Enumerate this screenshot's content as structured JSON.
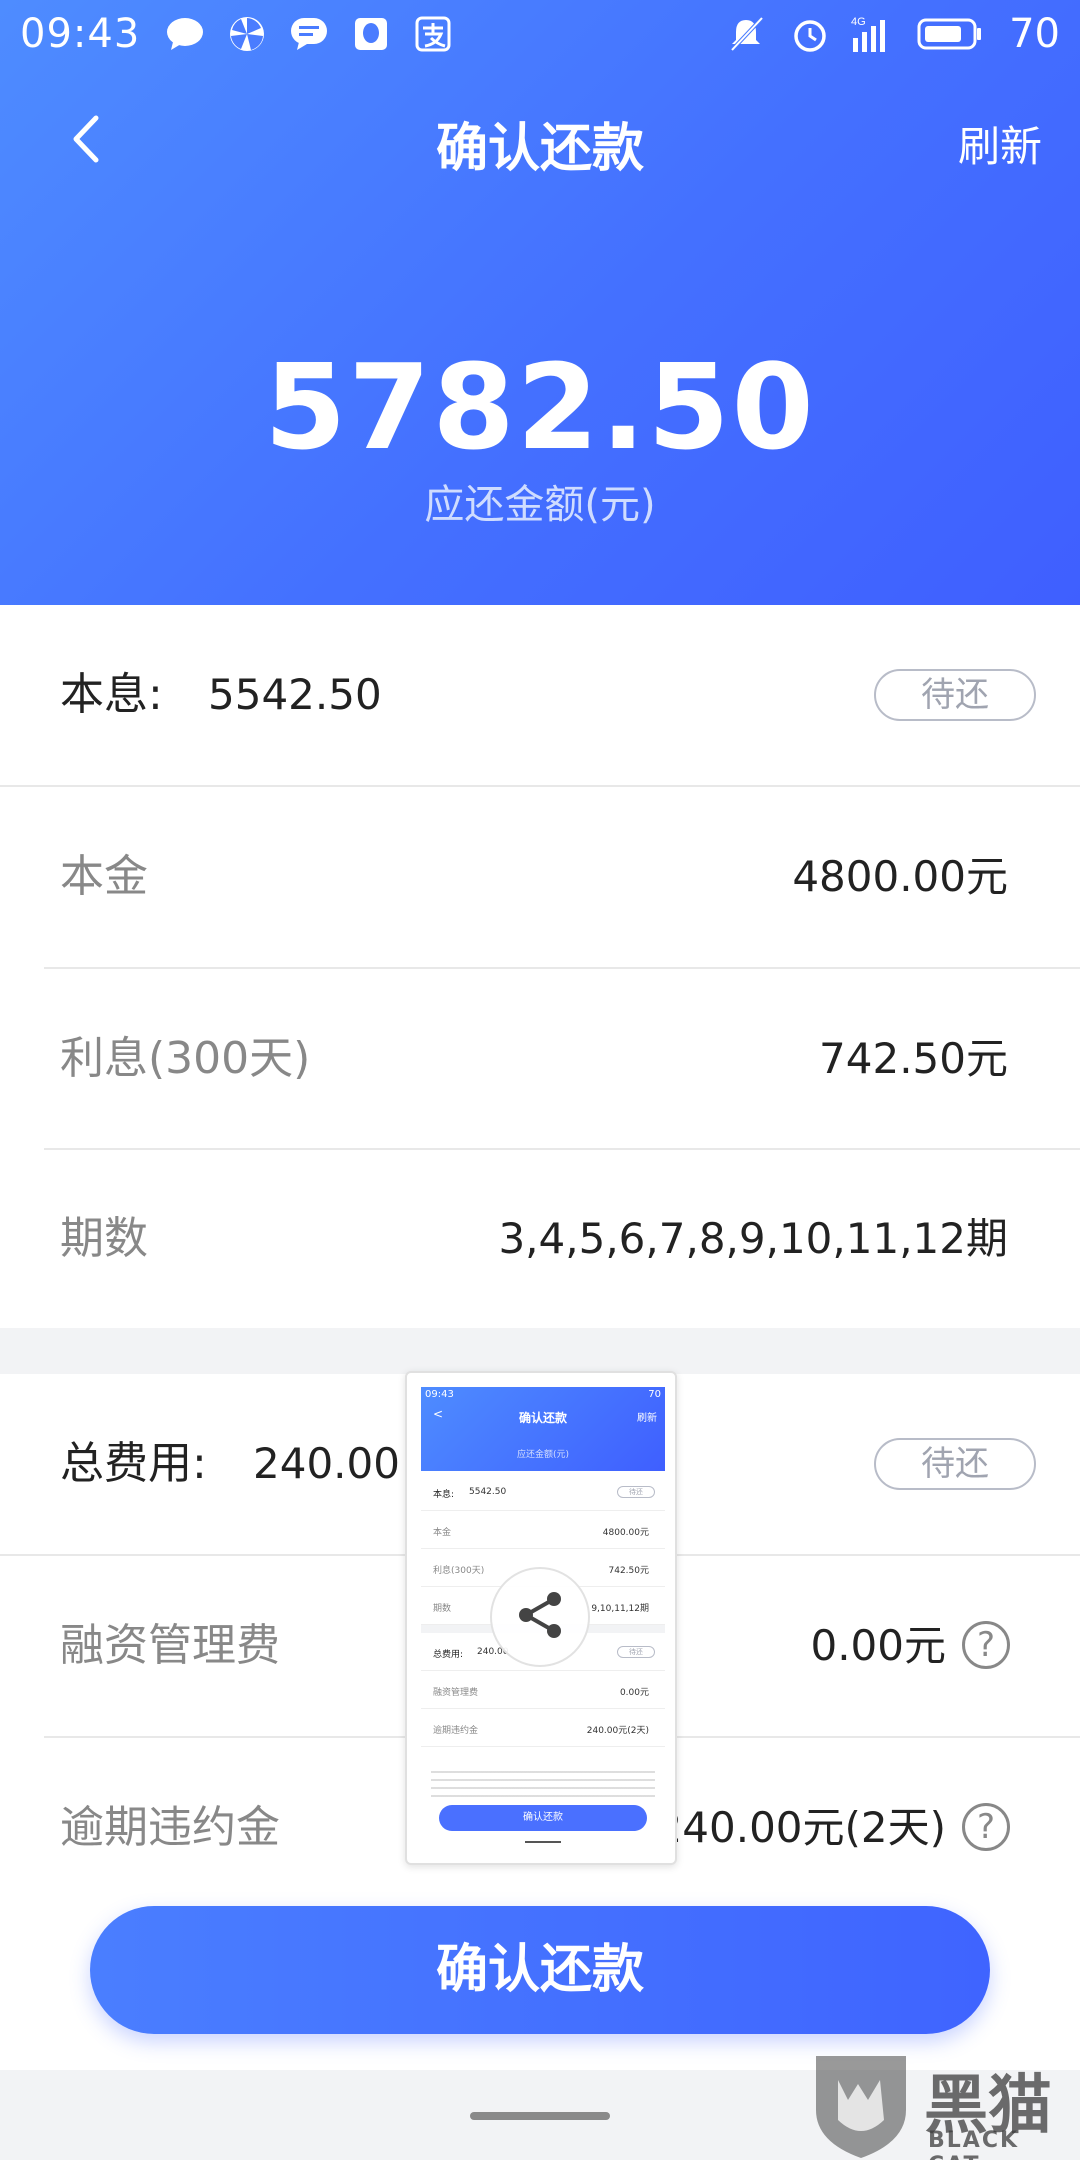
{
  "status_bar": {
    "time": "09:43",
    "network": "4G",
    "battery": "70"
  },
  "header": {
    "title": "确认还款",
    "refresh_label": "刷新",
    "amount": "5782.50",
    "amount_label": "应还金额(元)"
  },
  "principal_interest": {
    "label": "本息:",
    "value": "5542.50",
    "status": "待还",
    "items": [
      {
        "label": "本金",
        "value": "4800.00元"
      },
      {
        "label": "利息(300天)",
        "value": "742.50元"
      },
      {
        "label": "期数",
        "value": "3,4,5,6,7,8,9,10,11,12期"
      }
    ]
  },
  "fees": {
    "label": "总费用:",
    "value": "240.00",
    "status": "待还",
    "items": [
      {
        "label": "融资管理费",
        "value": "0.00元",
        "help": "?"
      },
      {
        "label": "逾期违约金",
        "value": "240.00元(2天)",
        "help": "?"
      }
    ]
  },
  "confirm_button": "确认还款",
  "thumbnail": {
    "time": "09:43",
    "battery": "70",
    "title": "确认还款",
    "refresh": "刷新",
    "amount_label": "应还金额(元)",
    "rows": [
      {
        "label": "本息:",
        "value": "5542.50",
        "badge": "待还"
      },
      {
        "label": "本金",
        "value": "4800.00元"
      },
      {
        "label": "利息(300天)",
        "value": "742.50元"
      },
      {
        "label": "期数",
        "value": "9,10,11,12期"
      },
      {
        "label": "总费用:",
        "value": "240.00",
        "badge": "待还"
      },
      {
        "label": "融资管理费",
        "value": "0.00元"
      },
      {
        "label": "逾期违约金",
        "value": "240.00元(2天)"
      }
    ],
    "button": "确认还款"
  },
  "watermark": {
    "text": "黑猫",
    "sub": "BLACK CAT"
  },
  "colors": {
    "accent": "#4470ff",
    "header_start": "#4e8cff",
    "header_end": "#3f5fff",
    "badge_border": "#b8bcc8"
  }
}
